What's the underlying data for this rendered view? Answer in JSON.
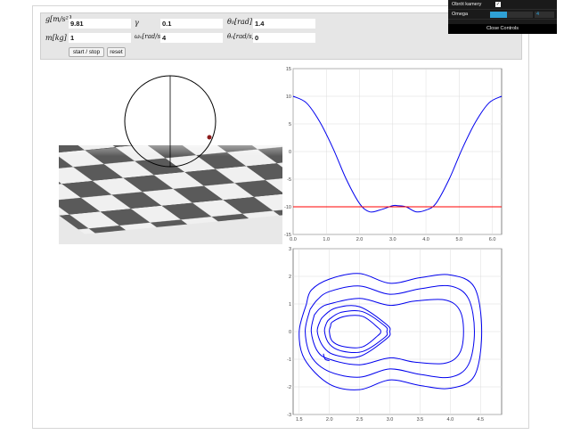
{
  "params": {
    "g_label": "g[m/s²]",
    "g_value": "9.81",
    "gamma_label": "γ",
    "gamma_value": "0.1",
    "theta0_label": "θ₀[rad]",
    "theta0_value": "1.4",
    "m_label": "m[kg]",
    "m_value": "1",
    "omega0_label": "ω₀[rad/s]",
    "omega0_value": "4",
    "thetadot0_label": "θ̇₀[rad/s]",
    "thetadot0_value": "0"
  },
  "buttons": {
    "start_stop": "start / stop",
    "reset": "reset"
  },
  "gui": {
    "camera_label": "Obrót kamery",
    "camera_checked": true,
    "omega_label": "Omega",
    "omega_value": "4",
    "omega_fraction": 0.4,
    "close_label": "Close Controls"
  },
  "colors": {
    "curve": "#0000ee",
    "reference": "#ff0000",
    "gui_accent": "#2fa1d6"
  },
  "chart_data": [
    {
      "type": "line",
      "title": "",
      "xlim": [
        0,
        6.28
      ],
      "ylim": [
        -15,
        15
      ],
      "xticks": [
        "0.0",
        "1.0",
        "2.0",
        "3.0",
        "4.0",
        "5.0",
        "6.0"
      ],
      "yticks": [
        "15",
        "10",
        "5",
        "0",
        "-5",
        "-10",
        "-15"
      ],
      "grid": true,
      "series": [
        {
          "x": [
            0,
            0.4,
            0.8,
            1.2,
            1.6,
            2.0,
            2.3,
            2.6,
            3.0,
            3.14,
            3.4,
            3.7,
            4.0,
            4.3,
            4.7,
            5.1,
            5.5,
            5.9,
            6.28
          ],
          "y": [
            10,
            8.8,
            5.4,
            0.6,
            -5.0,
            -9.4,
            -10.9,
            -10.6,
            -9.8,
            -9.8,
            -10.0,
            -10.9,
            -10.6,
            -9.4,
            -5.0,
            0.6,
            5.4,
            8.8,
            10
          ]
        },
        {
          "x": [
            0,
            6.28
          ],
          "y": [
            -10,
            -10
          ]
        }
      ]
    },
    {
      "type": "line",
      "title": "",
      "xlim": [
        1.4,
        4.85
      ],
      "ylim": [
        -3,
        3
      ],
      "xticks": [
        "1.5",
        "2.0",
        "2.5",
        "3.0",
        "3.5",
        "4.0",
        "4.5"
      ],
      "yticks": [
        "3",
        "2",
        "1",
        "0",
        "-1",
        "-2",
        "-3"
      ],
      "grid": true,
      "series": [
        {
          "x": [
            1.62,
            1.5,
            1.59,
            2.0,
            2.5,
            3.0,
            3.5,
            4.0,
            4.4,
            4.52,
            4.4,
            4.0,
            3.5,
            3.0,
            2.5,
            2.0,
            1.7,
            1.62
          ],
          "y": [
            1.0,
            0.0,
            -1.0,
            -1.9,
            -2.1,
            -1.75,
            -1.95,
            -2.05,
            -1.6,
            0.0,
            1.6,
            2.05,
            1.95,
            1.75,
            2.1,
            1.9,
            1.5,
            1.0
          ]
        },
        {
          "x": [
            1.68,
            1.6,
            1.7,
            2.0,
            2.5,
            3.0,
            3.5,
            4.0,
            4.3,
            4.4,
            4.3,
            4.0,
            3.5,
            3.0,
            2.5,
            2.0,
            1.8,
            1.68
          ],
          "y": [
            0.8,
            0.0,
            -0.9,
            -1.45,
            -1.65,
            -1.35,
            -1.55,
            -1.65,
            -1.2,
            0.0,
            1.2,
            1.65,
            1.55,
            1.35,
            1.65,
            1.45,
            1.15,
            0.8
          ]
        },
        {
          "x": [
            1.75,
            1.7,
            1.8,
            2.0,
            2.5,
            3.0,
            3.4,
            3.9,
            4.15,
            4.22,
            4.15,
            3.9,
            3.4,
            3.0,
            2.5,
            2.0,
            1.85,
            1.75
          ],
          "y": [
            0.6,
            0.0,
            -0.7,
            -1.0,
            -1.2,
            -0.95,
            -1.1,
            -1.15,
            -0.8,
            0.0,
            0.8,
            1.15,
            1.1,
            0.95,
            1.2,
            1.0,
            0.85,
            0.6
          ]
        },
        {
          "x": [
            1.85,
            1.8,
            1.9,
            2.1,
            2.5,
            2.95,
            3.0,
            2.95,
            2.5,
            2.1,
            1.9,
            1.85
          ],
          "y": [
            0.4,
            0.0,
            -0.55,
            -0.85,
            -0.9,
            -0.25,
            0.0,
            0.25,
            0.9,
            0.85,
            0.55,
            0.4
          ]
        },
        {
          "x": [
            1.95,
            1.92,
            2.0,
            2.2,
            2.55,
            2.92,
            2.95,
            2.92,
            2.55,
            2.2,
            2.0,
            1.95
          ],
          "y": [
            0.3,
            0.0,
            -0.45,
            -0.7,
            -0.72,
            -0.2,
            0.0,
            0.2,
            0.72,
            0.7,
            0.45,
            0.3
          ]
        },
        {
          "x": [
            2.02,
            2.0,
            2.05,
            2.25,
            2.55,
            2.8,
            2.85,
            2.8,
            2.55,
            2.25,
            2.05,
            2.02
          ],
          "y": [
            0.2,
            0.0,
            -0.35,
            -0.55,
            -0.55,
            -0.15,
            0.0,
            0.15,
            0.55,
            0.55,
            0.35,
            0.2
          ]
        },
        {
          "x": [
            1.9,
            1.93,
            2.0
          ],
          "y": [
            -0.8,
            -1.0,
            -1.05
          ]
        }
      ]
    }
  ]
}
